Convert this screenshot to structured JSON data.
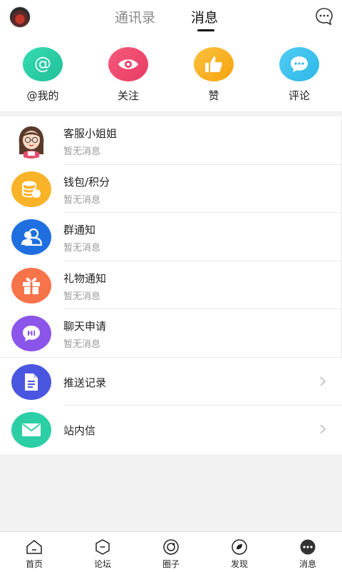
{
  "header": {
    "tabs": [
      {
        "label": "通讯录"
      },
      {
        "label": "消息"
      }
    ],
    "active_tab": "消息"
  },
  "quick_actions": [
    {
      "label": "@我的",
      "icon": "at-icon",
      "color": "#2ccfa5"
    },
    {
      "label": "关注",
      "icon": "eye-icon",
      "color": "#f04a6e"
    },
    {
      "label": "赞",
      "icon": "thumbs-up-icon",
      "color": "#f9b120"
    },
    {
      "label": "评论",
      "icon": "comment-icon",
      "color": "#3fc2ee"
    }
  ],
  "messages": [
    {
      "title": "客服小姐姐",
      "subtitle": "暂无消息",
      "icon": "customer-service-avatar"
    },
    {
      "title": "钱包/积分",
      "subtitle": "暂无消息",
      "icon": "coins-icon",
      "color": "#f9b329"
    },
    {
      "title": "群通知",
      "subtitle": "暂无消息",
      "icon": "group-icon",
      "color": "#1f6fe0"
    },
    {
      "title": "礼物通知",
      "subtitle": "暂无消息",
      "icon": "gift-icon",
      "color": "#f7734a"
    },
    {
      "title": "聊天申请",
      "subtitle": "暂无消息",
      "icon": "hi-chat-icon",
      "color": "#8a55e8"
    }
  ],
  "links": [
    {
      "title": "推送记录",
      "icon": "document-icon",
      "color": "#4a56e0"
    },
    {
      "title": "站内信",
      "icon": "mail-icon",
      "color": "#2ccfa5"
    }
  ],
  "bottom_nav": [
    {
      "label": "首页",
      "icon": "home-icon"
    },
    {
      "label": "论坛",
      "icon": "forum-icon"
    },
    {
      "label": "圈子",
      "icon": "circle-icon"
    },
    {
      "label": "发现",
      "icon": "discover-icon"
    },
    {
      "label": "消息",
      "icon": "messages-icon"
    }
  ]
}
